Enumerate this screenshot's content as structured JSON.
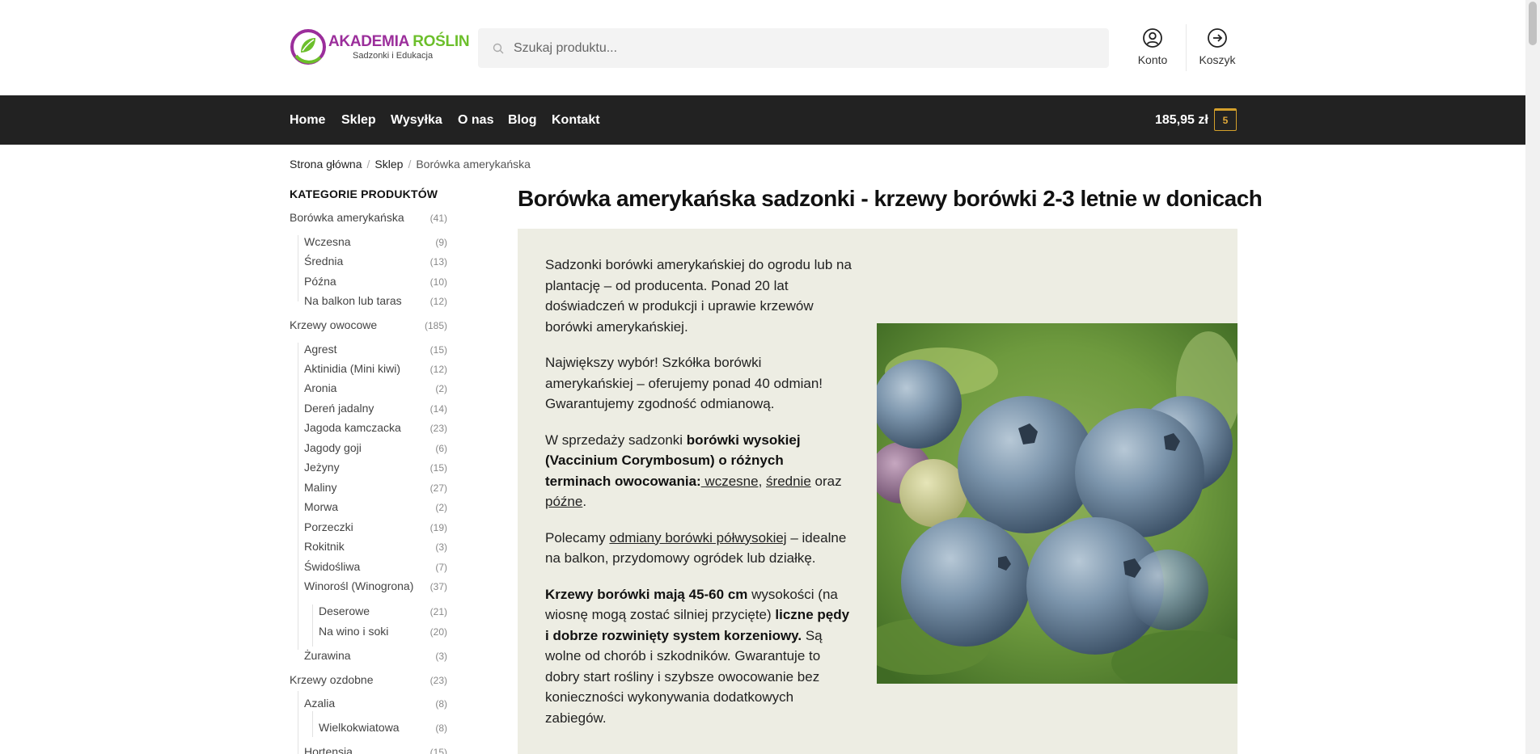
{
  "header": {
    "logo_title_a": "AKADEMIA ",
    "logo_title_b": "ROŚLIN",
    "logo_subtitle": "Sadzonki i Edukacja",
    "search_placeholder": "Szukaj produktu...",
    "account_label": "Konto",
    "cart_label": "Koszyk"
  },
  "nav": {
    "items": [
      "Home",
      "Sklep",
      "Wysyłka",
      "O nas",
      "Blog",
      "Kontakt"
    ],
    "cart_total": "185,95 zł",
    "cart_count": "5"
  },
  "breadcrumb": [
    "Strona główna",
    "Sklep",
    "Borówka amerykańska"
  ],
  "sidebar": {
    "title": "KATEGORIE PRODUKTÓW",
    "categories": [
      {
        "name": "Borówka amerykańska",
        "count": "(41)"
      },
      {
        "name": "Wczesna",
        "count": "(9)"
      },
      {
        "name": "Średnia",
        "count": "(13)"
      },
      {
        "name": "Późna",
        "count": "(10)"
      },
      {
        "name": "Na balkon lub taras",
        "count": "(12)"
      },
      {
        "name": "Krzewy owocowe",
        "count": "(185)"
      },
      {
        "name": "Agrest",
        "count": "(15)"
      },
      {
        "name": "Aktinidia (Mini kiwi)",
        "count": "(12)"
      },
      {
        "name": "Aronia",
        "count": "(2)"
      },
      {
        "name": "Dereń jadalny",
        "count": "(14)"
      },
      {
        "name": "Jagoda kamczacka",
        "count": "(23)"
      },
      {
        "name": "Jagody goji",
        "count": "(6)"
      },
      {
        "name": "Jeżyny",
        "count": "(15)"
      },
      {
        "name": "Maliny",
        "count": "(27)"
      },
      {
        "name": "Morwa",
        "count": "(2)"
      },
      {
        "name": "Porzeczki",
        "count": "(19)"
      },
      {
        "name": "Rokitnik",
        "count": "(3)"
      },
      {
        "name": "Świdośliwa",
        "count": "(7)"
      },
      {
        "name": "Winorośl (Winogrona)",
        "count": "(37)"
      },
      {
        "name": "Deserowe",
        "count": "(21)"
      },
      {
        "name": "Na wino i soki",
        "count": "(20)"
      },
      {
        "name": "Żurawina",
        "count": "(3)"
      },
      {
        "name": "Krzewy ozdobne",
        "count": "(23)"
      },
      {
        "name": "Azalia",
        "count": "(8)"
      },
      {
        "name": "Wielkokwiatowa",
        "count": "(8)"
      },
      {
        "name": "Hortensja",
        "count": "(15)"
      }
    ]
  },
  "product": {
    "title": "Borówka amerykańska sadzonki - krzewy borówki 2-3 letnie w donicach",
    "p1": "Sadzonki borówki amerykańskiej do ogrodu lub na plantację – od producenta. Ponad 20 lat doświadczeń w produkcji i uprawie krzewów borówki amerykańskiej.",
    "p2": "Największy wybór! Szkółka borówki amerykańskiej – oferujemy ponad 40 odmian! Gwarantujemy zgodność odmianową.",
    "p3_a": "W sprzedaży sadzonki ",
    "p3_b": "borówki wysokiej (Vaccinium Corymbosum) o różnych terminach owocowania:",
    "p3_link1": " wczesne",
    "p3_c": ", ",
    "p3_link2": "średnie",
    "p3_d": " oraz ",
    "p3_link3": "późne",
    "p3_e": ".",
    "p4_a": "Polecamy ",
    "p4_link": "odmiany borówki półwysokiej",
    "p4_b": " – idealne na balkon, przydomowy ogródek lub działkę.",
    "p5_a": "Krzewy borówki mają 45-60 cm",
    "p5_b": " wysokości (na wiosnę mogą zostać silniej przycięte) ",
    "p5_c": "liczne pędy i dobrze rozwinięty system korzeniowy.",
    "p5_d": " Są wolne od chorób i szkodników. Gwarantuje to dobry start rośliny i szybsze owocowanie bez konieczności wykonywania dodatkowych zabiegów."
  },
  "colors": {
    "nav_bg": "#222222",
    "accent": "#d4a02b",
    "desc_bg": "#ededE3",
    "logo_purple": "#9b2e9b",
    "logo_green": "#6cbf2b"
  }
}
